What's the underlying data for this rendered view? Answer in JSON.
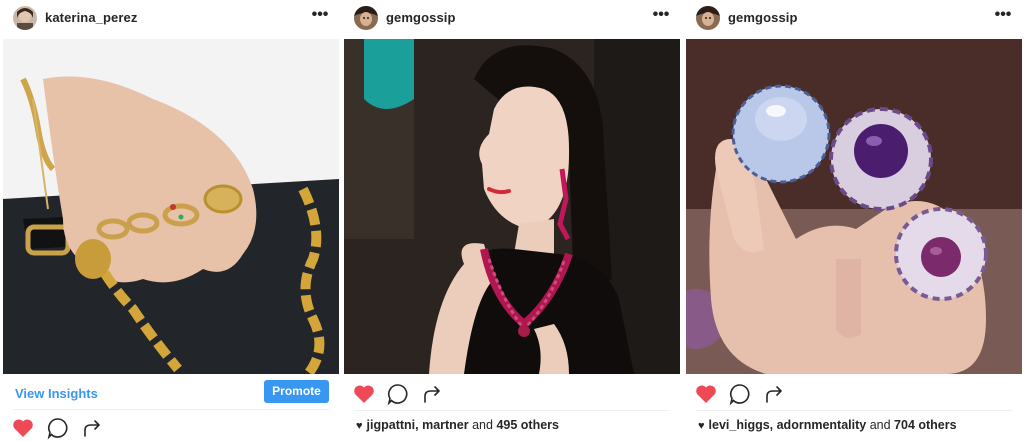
{
  "posts": [
    {
      "username": "katerina_perez",
      "menu_label": "•••",
      "photo_subject": "gold rings on hand with chain",
      "view_insights_label": "View Insights",
      "promote_label": "Promote",
      "liked": true
    },
    {
      "username": "gemgossip",
      "menu_label": "•••",
      "photo_subject": "woman wearing red jeweled necklace and earrings",
      "liked": true,
      "likes": {
        "names": "jigpattni, martner",
        "joiner": "and",
        "others": "495 others"
      }
    },
    {
      "username": "gemgossip",
      "menu_label": "•••",
      "photo_subject": "three enamel flower rings on hand",
      "liked": true,
      "likes": {
        "names": "levi_higgs, adornmentality",
        "joiner": "and",
        "others": "704 others"
      }
    }
  ],
  "colors": {
    "accent": "#3897f0",
    "heart": "#ed4956",
    "text": "#262626",
    "divider": "#efefef"
  }
}
